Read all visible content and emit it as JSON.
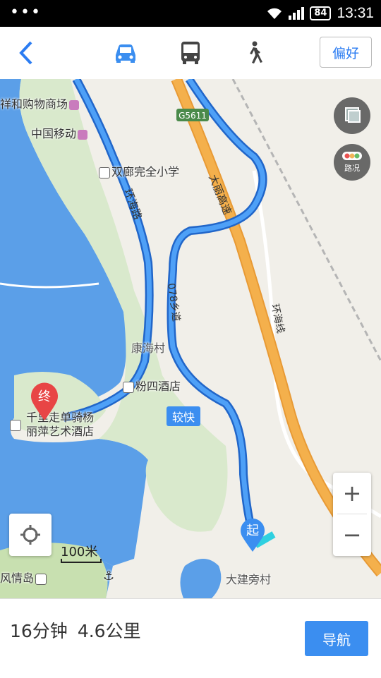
{
  "status_bar": {
    "dots": "•••",
    "battery": "84",
    "time": "13:31"
  },
  "top_bar": {
    "back_icon": "back-chevron-icon",
    "modes": [
      {
        "name": "car",
        "icon": "car-icon",
        "active": true,
        "color": "#3b8ef0"
      },
      {
        "name": "bus",
        "icon": "bus-icon",
        "active": false,
        "color": "#444444"
      },
      {
        "name": "walk",
        "icon": "walk-icon",
        "active": false,
        "color": "#444444"
      }
    ],
    "preference_label": "偏好"
  },
  "map": {
    "labels": {
      "shopping": "祥和购物商场",
      "china_mobile": "中国移动",
      "school": "双廊完全小学",
      "huanhai_road": "环海路",
      "highway_code": "G5611",
      "dali_highway": "大丽高速",
      "township_road": "078乡道",
      "huanhai_line": "环海线",
      "kanghai_village": "康海村",
      "fensi_hotel": "粉四酒店",
      "dest_hotel_line1": "千里走单骑杨",
      "dest_hotel_line2": "丽萍艺术酒店",
      "fengqing_island": "风情岛",
      "dajianpang_village": "大建旁村"
    },
    "start_marker": "起",
    "end_marker": "终",
    "faster_tag": "较快",
    "traffic_label": "路况",
    "scale_label": "100米",
    "zoom_in": "+",
    "zoom_out": "−",
    "colors": {
      "water": "#5b9fe8",
      "land": "#f1efe9",
      "green": "#d9e9cc",
      "route": "#3f8ff0",
      "highway": "#f4a23c"
    }
  },
  "bottom": {
    "duration": "16分钟",
    "distance": "4.6公里",
    "navigate_label": "导航"
  }
}
